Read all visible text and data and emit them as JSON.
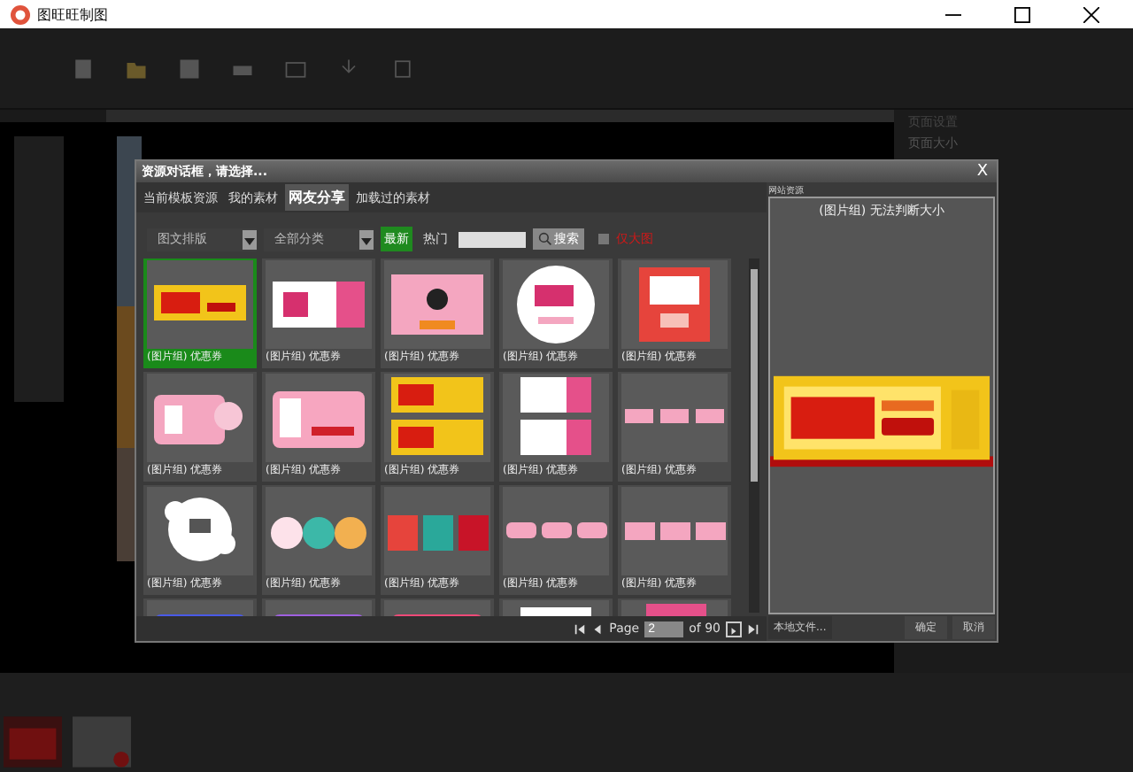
{
  "window": {
    "title": "图旺旺制图"
  },
  "side_panel": {
    "title": "页面设置",
    "section": "页面大小"
  },
  "dialog": {
    "title": "资源对话框，请选择...",
    "close": "X",
    "tabs": [
      {
        "label": "当前模板资源",
        "selected": false
      },
      {
        "label": "我的素材",
        "selected": false
      },
      {
        "label": "网友分享",
        "selected": true
      },
      {
        "label": "加载过的素材",
        "selected": false
      }
    ],
    "filters": {
      "layout": "图文排版",
      "category": "全部分类",
      "sorts": [
        {
          "label": "最新",
          "selected": true
        },
        {
          "label": "热门",
          "selected": false
        }
      ],
      "search_button": "搜索",
      "option": {
        "label": "仅大图",
        "checked": false
      }
    },
    "items": [
      {
        "caption": "(图片组) 优惠券",
        "selected": true
      },
      {
        "caption": "(图片组) 优惠券",
        "selected": false
      },
      {
        "caption": "(图片组) 优惠券",
        "selected": false
      },
      {
        "caption": "(图片组) 优惠券",
        "selected": false
      },
      {
        "caption": "(图片组) 优惠券",
        "selected": false
      },
      {
        "caption": "(图片组) 优惠券",
        "selected": false
      },
      {
        "caption": "(图片组) 优惠券",
        "selected": false
      },
      {
        "caption": "(图片组) 优惠券",
        "selected": false
      },
      {
        "caption": "(图片组) 优惠券",
        "selected": false
      },
      {
        "caption": "(图片组) 优惠券",
        "selected": false
      },
      {
        "caption": "(图片组) 优惠券",
        "selected": false
      },
      {
        "caption": "(图片组) 优惠券",
        "selected": false
      },
      {
        "caption": "(图片组) 优惠券",
        "selected": false
      },
      {
        "caption": "(图片组) 优惠券",
        "selected": false
      },
      {
        "caption": "(图片组) 优惠券",
        "selected": false
      },
      {
        "selected": false
      },
      {
        "selected": false
      },
      {
        "selected": false
      },
      {
        "selected": false
      },
      {
        "selected": false
      }
    ],
    "pager": {
      "label": "Page",
      "page": "2",
      "of": "of 90"
    },
    "preview": {
      "source": "网站资源",
      "caption": "(图片组) 无法判断大小"
    },
    "buttons": {
      "local": "本地文件...",
      "ok": "确定",
      "cancel": "取消"
    }
  }
}
